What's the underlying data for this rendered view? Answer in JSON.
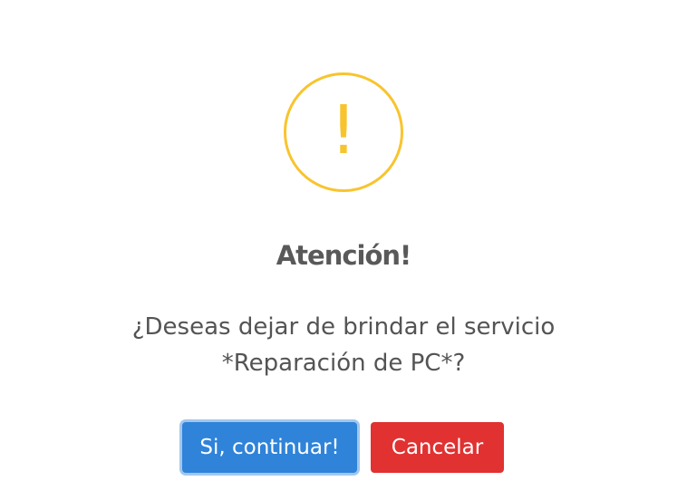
{
  "dialog": {
    "icon": "exclamation-warning-icon",
    "title": "Atención!",
    "message_lines": [
      "¿Deseas dejar de brindar el servicio",
      "*Reparación de PC*?"
    ],
    "buttons": {
      "confirm": "Si, continuar!",
      "cancel": "Cancelar"
    },
    "colors": {
      "warning": "#f8c42e",
      "confirm": "#2f83d8",
      "cancel": "#e13131",
      "title": "#595959",
      "message": "#545454"
    }
  }
}
